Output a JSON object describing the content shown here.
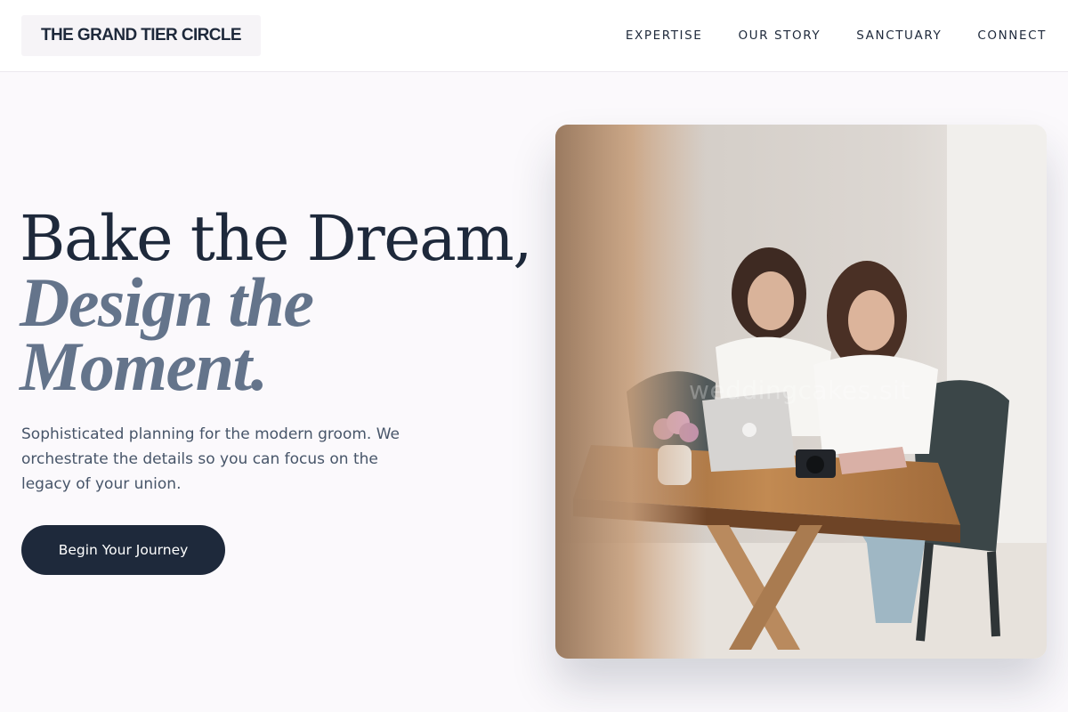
{
  "header": {
    "logo": "THE GRAND TIER CIRCLE",
    "nav": [
      "EXPERTISE",
      "OUR STORY",
      "SANCTUARY",
      "CONNECT"
    ]
  },
  "hero": {
    "title_line1": "Bake the Dream,",
    "title_line2": "Design the",
    "title_line3": "Moment.",
    "subtitle": "Sophisticated planning for the modern groom. We orchestrate the details so you can focus on the legacy of your union.",
    "cta": "Begin Your Journey",
    "image": {
      "watermark": "weddingcakes.sit"
    }
  },
  "colors": {
    "primary": "#1e293b",
    "accent": "#64748b",
    "background": "#fbf9fc"
  }
}
